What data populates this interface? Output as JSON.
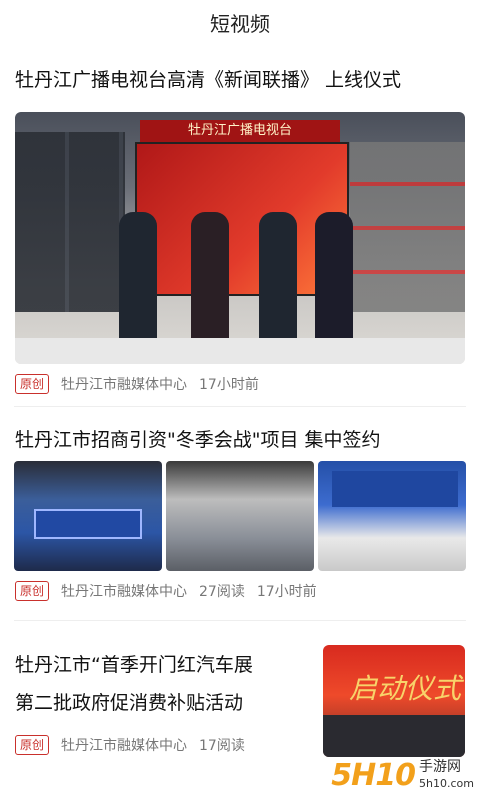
{
  "header": {
    "title": "短视频"
  },
  "articles": [
    {
      "title": "牡丹江广播电视台高清《新闻联播》 上线仪式",
      "tag": "原创",
      "source": "牡丹江市融媒体中心",
      "time": "17小时前",
      "image_text": "牡丹江广播电视台"
    },
    {
      "title": "牡丹江市招商引资\"冬季会战\"项目 集中签约",
      "tag": "原创",
      "source": "牡丹江市融媒体中心",
      "reads": "27阅读",
      "time": "17小时前"
    },
    {
      "title_line1": "牡丹江市“首季开门红汽车展",
      "title_line2": "第二批政府促消费补贴活动",
      "tag": "原创",
      "source": "牡丹江市融媒体中心",
      "reads": "17阅读",
      "image_text": "启动仪式"
    }
  ],
  "watermark": {
    "number": "5H10",
    "site": "手游网",
    "domain": "5h10.com"
  }
}
